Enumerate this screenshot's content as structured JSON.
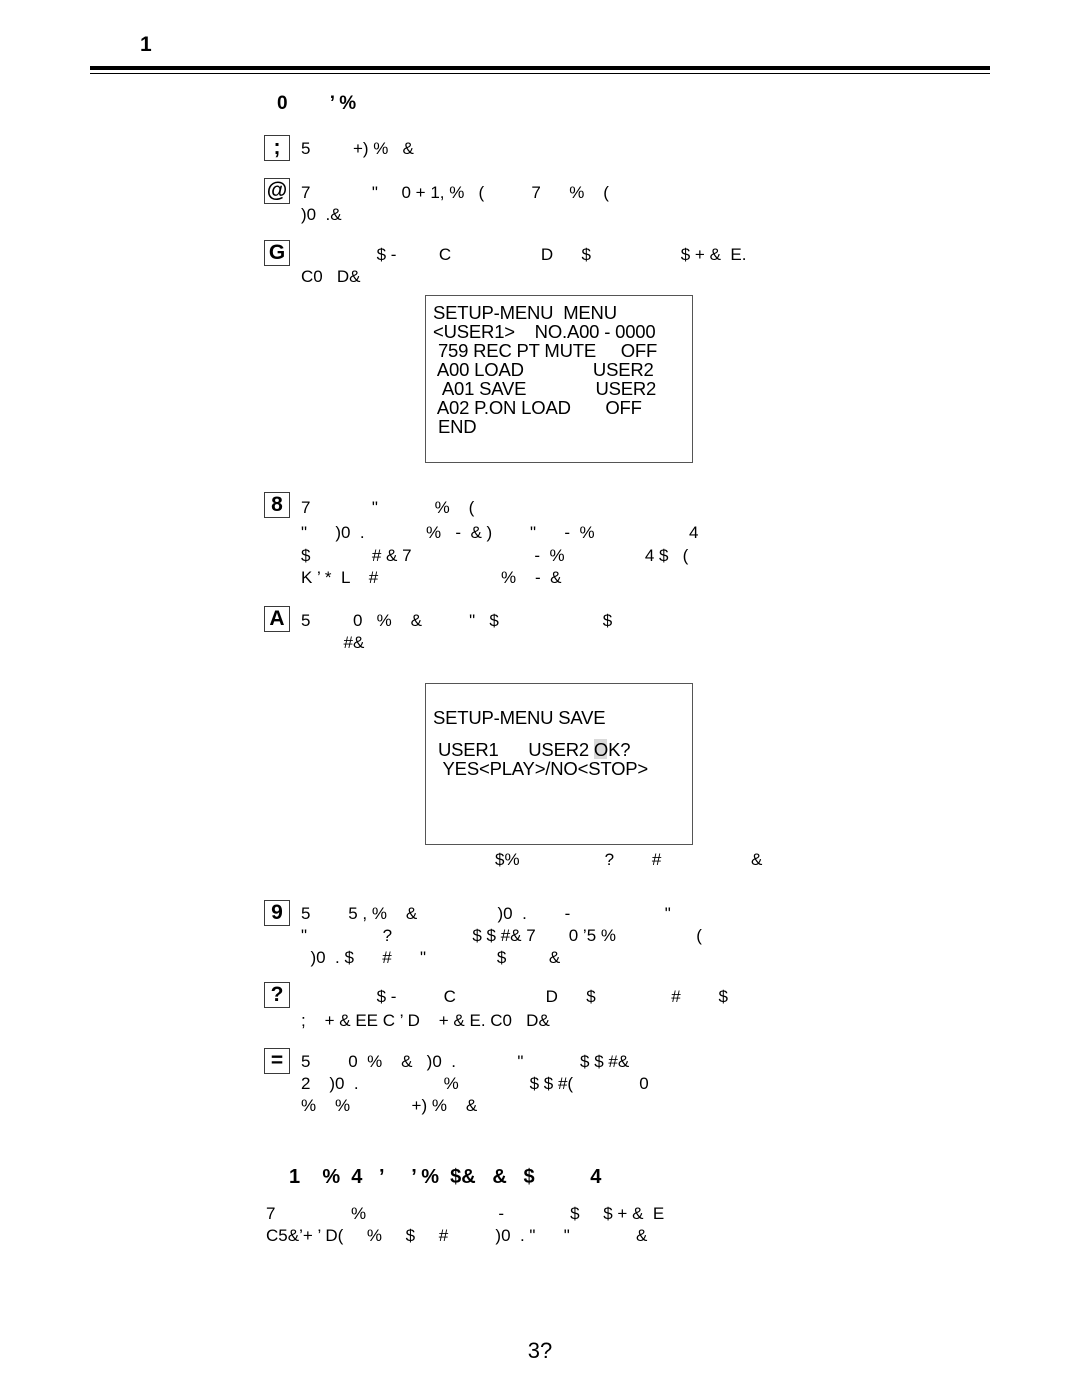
{
  "page": {
    "header_number": "1",
    "footer_number": "3?"
  },
  "intro": {
    "title": "0        ’ %"
  },
  "steps": [
    {
      "marker": ";",
      "marker_name": "step-marker-1",
      "lines": [
        "5         +) %   &"
      ]
    },
    {
      "marker": "@",
      "marker_name": "step-marker-2",
      "lines": [
        "7             \"     0 + 1, %   (          7      %    (",
        ")0  .&"
      ]
    },
    {
      "marker": "G",
      "marker_name": "step-marker-3",
      "lines": [
        "                $ -         C                   D      $                   $ + &  E.",
        "C0   D&"
      ]
    },
    {
      "marker": "8",
      "marker_name": "step-marker-4",
      "lines": [
        "7             \"            %    (",
        "\"      )0  .             %   -  & )        \"      -  %                    4",
        "$             # & 7                          -  %                 4 $   (",
        "K ’ *  L    #                          %    -  &"
      ]
    },
    {
      "marker": "A",
      "marker_name": "step-marker-5",
      "lines": [
        "5         0   %    &          \"   $                      $",
        "         #&"
      ]
    },
    {
      "marker": "9",
      "marker_name": "step-marker-6",
      "lines": [
        "5        5 , %    &                 )0  .        -                    \"",
        "\"                ?                 $ $ #& 7       0 ’5 %                 (",
        "  )0  . $      #      \"               $         &"
      ]
    },
    {
      "marker": "?",
      "marker_name": "step-marker-7",
      "lines": [
        "                $ -          C                   D      $                #        $",
        ";    + & EE C ’ D    + & E. C0   D&"
      ]
    },
    {
      "marker": "=",
      "marker_name": "step-marker-8",
      "lines": [
        "5        0  %    &   )0  .             \"            $ $ #&",
        "2    )0  .                  %               $ $ #(              0",
        "%    %             +) %    &"
      ]
    }
  ],
  "caption_under_save_box": "$%                  ?        #                   &",
  "lcd_menu_display": {
    "name": "setup-menu-menu-display",
    "lines": [
      "SETUP-MENU  MENU",
      "<USER1>    NO.A00 - 0000",
      " 759 REC PT MUTE     OFF",
      " A00 LOAD              USER2",
      "  A01 SAVE              USER2",
      " A02 P.ON LOAD       OFF",
      " END"
    ]
  },
  "lcd_save_display": {
    "name": "setup-menu-save-display",
    "lines": [
      "SETUP-MENU SAVE",
      " USER1      USER2 OK?",
      "  YES<PLAY>/NO<STOP>"
    ]
  },
  "section": {
    "heading": "1    %  4   ’     ’ %  $&   &   $          4",
    "lines": [
      "7                %                            -              $     $ + &  E",
      "C5&’+ ’ D(     %     $     #          )0  . \"      \"              &"
    ]
  }
}
